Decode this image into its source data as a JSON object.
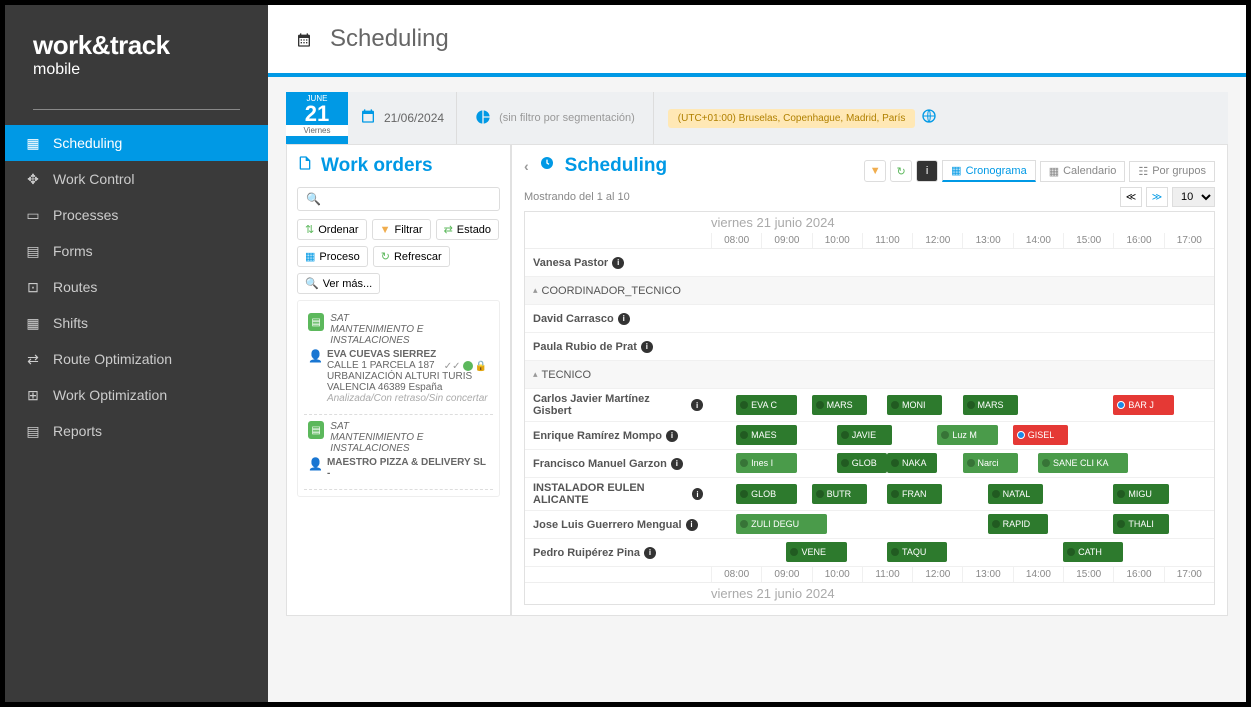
{
  "brand": {
    "main": "work&track",
    "sub": "mobile"
  },
  "nav": [
    {
      "label": "Scheduling",
      "active": true
    },
    {
      "label": "Work Control"
    },
    {
      "label": "Processes"
    },
    {
      "label": "Forms"
    },
    {
      "label": "Routes"
    },
    {
      "label": "Shifts"
    },
    {
      "label": "Route Optimization"
    },
    {
      "label": "Work Optimization"
    },
    {
      "label": "Reports"
    }
  ],
  "header": {
    "title": "Scheduling"
  },
  "date": {
    "month": "JUNE",
    "day": "21",
    "weekday": "Viernes",
    "full": "21/06/2024"
  },
  "segFilter": "(sin filtro por segmentación)",
  "tz": "(UTC+01:00) Bruselas, Copenhague, Madrid, París",
  "workOrders": {
    "title": "Work orders",
    "search_placeholder": "",
    "buttons": {
      "ordenar": "Ordenar",
      "filtrar": "Filtrar",
      "estado": "Estado",
      "proceso": "Proceso",
      "refrescar": "Refrescar",
      "vermas": "Ver más..."
    },
    "cards": [
      {
        "cat": "SAT",
        "type": "MANTENIMIENTO E INSTALACIONES",
        "person": "EVA CUEVAS SIERREZ",
        "addr1": "CALLE 1 PARCELA 187",
        "addr2": "URBANIZACIÓN ALTURI TURIS",
        "addr3": "VALENCIA 46389 España",
        "status": "Analizada/Con retraso/Sin concertar"
      },
      {
        "cat": "SAT",
        "type": "MANTENIMIENTO E INSTALACIONES",
        "person": "MAESTRO PIZZA & DELIVERY SL -"
      }
    ]
  },
  "scheduling": {
    "title": "Scheduling",
    "showing": "Mostrando del 1 al 10",
    "pageSize": "10",
    "views": {
      "cronograma": "Cronograma",
      "calendario": "Calendario",
      "porgrupos": "Por grupos"
    },
    "dateLabel": "viernes 21 junio 2024",
    "hours": [
      "08:00",
      "09:00",
      "10:00",
      "11:00",
      "12:00",
      "13:00",
      "14:00",
      "15:00",
      "16:00",
      "17:00"
    ],
    "rows": [
      {
        "name": "Vanesa Pastor",
        "type": "person",
        "tasks": []
      },
      {
        "name": "COORDINADOR_TECNICO",
        "type": "group"
      },
      {
        "name": "David Carrasco",
        "type": "person",
        "tasks": []
      },
      {
        "name": "Paula Rubio de Prat",
        "type": "person",
        "tasks": []
      },
      {
        "name": "TECNICO",
        "type": "group"
      },
      {
        "name": "Carlos Javier Martínez Gisbert",
        "type": "person",
        "tasks": [
          {
            "l": "EVA C",
            "s": 8,
            "w": 1.2,
            "c": "g"
          },
          {
            "l": "MARS",
            "s": 9.5,
            "w": 1.1,
            "c": "g"
          },
          {
            "l": "MONI",
            "s": 11,
            "w": 1.1,
            "c": "g"
          },
          {
            "l": "MARS",
            "s": 12.5,
            "w": 1.1,
            "c": "g"
          },
          {
            "l": "BAR J",
            "s": 15.5,
            "w": 1.2,
            "c": "r"
          }
        ]
      },
      {
        "name": "Enrique Ramírez Mompo",
        "type": "person",
        "tasks": [
          {
            "l": "MAES",
            "s": 8,
            "w": 1.2,
            "c": "g"
          },
          {
            "l": "JAVIE",
            "s": 10,
            "w": 1.1,
            "c": "g"
          },
          {
            "l": "Luz M",
            "s": 12,
            "w": 1.2,
            "c": "g2"
          },
          {
            "l": "GISEL",
            "s": 13.5,
            "w": 1.1,
            "c": "r"
          }
        ]
      },
      {
        "name": "Francisco Manuel Garzon",
        "type": "person",
        "tasks": [
          {
            "l": "Ines I",
            "s": 8,
            "w": 1.2,
            "c": "g2"
          },
          {
            "l": "GLOB",
            "s": 10,
            "w": 1,
            "c": "g"
          },
          {
            "l": "NAKA",
            "s": 11,
            "w": 1,
            "c": "g"
          },
          {
            "l": "Narci",
            "s": 12.5,
            "w": 1.1,
            "c": "g2"
          },
          {
            "l": "SANE CLI KA",
            "s": 14,
            "w": 1.8,
            "c": "g2"
          }
        ]
      },
      {
        "name": "INSTALADOR EULEN ALICANTE",
        "type": "person",
        "tasks": [
          {
            "l": "GLOB",
            "s": 8,
            "w": 1.2,
            "c": "g"
          },
          {
            "l": "BUTR",
            "s": 9.5,
            "w": 1.1,
            "c": "g"
          },
          {
            "l": "FRAN",
            "s": 11,
            "w": 1.1,
            "c": "g"
          },
          {
            "l": "NATAL",
            "s": 13,
            "w": 1.1,
            "c": "g"
          },
          {
            "l": "MIGU",
            "s": 15.5,
            "w": 1.1,
            "c": "g"
          }
        ]
      },
      {
        "name": "Jose Luis Guerrero Mengual",
        "type": "person",
        "tasks": [
          {
            "l": "ZULI DEGU",
            "s": 8,
            "w": 1.8,
            "c": "g2"
          },
          {
            "l": "RAPID",
            "s": 13,
            "w": 1.2,
            "c": "g"
          },
          {
            "l": "THALI",
            "s": 15.5,
            "w": 1.1,
            "c": "g"
          }
        ]
      },
      {
        "name": "Pedro Ruipérez Pina",
        "type": "person",
        "tasks": [
          {
            "l": "VENE",
            "s": 9,
            "w": 1.2,
            "c": "g"
          },
          {
            "l": "TAQU",
            "s": 11,
            "w": 1.2,
            "c": "g"
          },
          {
            "l": "CATH",
            "s": 14.5,
            "w": 1.2,
            "c": "g"
          }
        ]
      }
    ]
  }
}
